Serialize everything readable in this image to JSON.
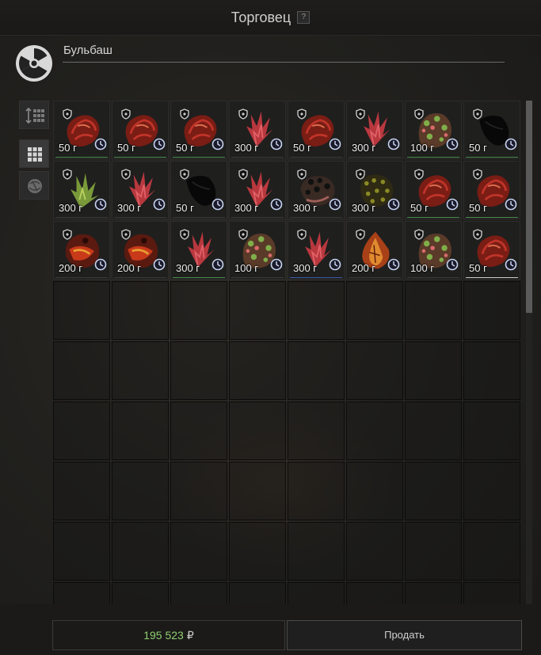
{
  "window": {
    "title": "Торговец",
    "help_label": "?"
  },
  "trader": {
    "name": "Бульбаш",
    "icon": "radiation-icon"
  },
  "sidebar": [
    {
      "icon": "sort-icon",
      "active": false
    },
    {
      "icon": "grid-view-icon",
      "active": true
    },
    {
      "icon": "artifact-filter-icon",
      "active": false
    }
  ],
  "items": [
    {
      "price": "50 г",
      "art": "meat",
      "line": "#4a8a4a"
    },
    {
      "price": "50 г",
      "art": "meat",
      "line": "#4a8a4a"
    },
    {
      "price": "50 г",
      "art": "meat",
      "line": "#4a8a4a"
    },
    {
      "price": "300 г",
      "art": "crystal",
      "line": "#3a3a3a"
    },
    {
      "price": "50 г",
      "art": "meat",
      "line": "#3a3a3a"
    },
    {
      "price": "300 г",
      "art": "crystal",
      "line": "#3a3a3a"
    },
    {
      "price": "100 г",
      "art": "moss",
      "line": "#4a8a4a"
    },
    {
      "price": "50 г",
      "art": "dark",
      "line": "#4a8a4a"
    },
    {
      "price": "300 г",
      "art": "green",
      "line": "#3a3a3a"
    },
    {
      "price": "300 г",
      "art": "crystal",
      "line": "#3a3a3a"
    },
    {
      "price": "50 г",
      "art": "dark",
      "line": "#3a3a3a"
    },
    {
      "price": "300 г",
      "art": "crystal",
      "line": "#3a3a3a"
    },
    {
      "price": "300 г",
      "art": "rock",
      "line": "#3a3a3a"
    },
    {
      "price": "300 г",
      "art": "olive",
      "line": "#3a3a3a"
    },
    {
      "price": "50 г",
      "art": "meat",
      "line": "#4a8a4a"
    },
    {
      "price": "50 г",
      "art": "meat",
      "line": "#4a8a4a"
    },
    {
      "price": "200 г",
      "art": "ember",
      "line": "#3a3a3a"
    },
    {
      "price": "200 г",
      "art": "ember",
      "line": "#3a3a3a"
    },
    {
      "price": "300 г",
      "art": "crystal",
      "line": "#4a8a4a"
    },
    {
      "price": "100 г",
      "art": "moss",
      "line": "#3a3a3a"
    },
    {
      "price": "300 г",
      "art": "crystal",
      "line": "#3a5aa8"
    },
    {
      "price": "200 г",
      "art": "flame",
      "line": "#3a3a3a"
    },
    {
      "price": "100 г",
      "art": "moss",
      "line": "#3a3a3a"
    },
    {
      "price": "50 г",
      "art": "meat",
      "line": "#cccccc"
    }
  ],
  "grid": {
    "columns": 8,
    "visible_rows": 9
  },
  "footer": {
    "balance": "195 523",
    "currency": "₽",
    "sell_label": "Продать"
  },
  "colors": {
    "balance": "#8fcf6f",
    "background": "#1c1b19"
  }
}
